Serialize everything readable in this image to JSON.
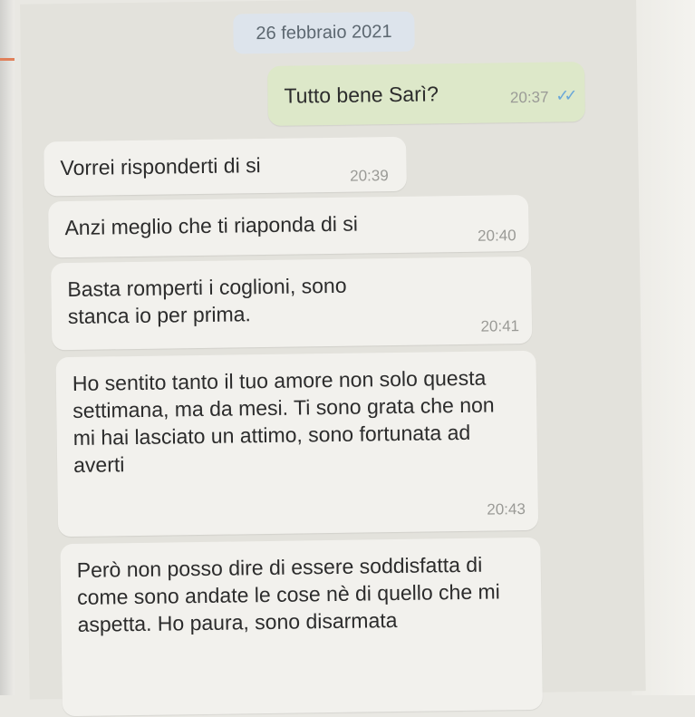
{
  "chat": {
    "date": "26 febbraio 2021",
    "messages": [
      {
        "direction": "outgoing",
        "text": "Tutto bene Sarì?",
        "time": "20:37",
        "status": "read-double-check"
      },
      {
        "direction": "incoming",
        "text": "Vorrei risponderti di si",
        "time": "20:39"
      },
      {
        "direction": "incoming",
        "text": "Anzi meglio che ti riaponda di si",
        "time": "20:40"
      },
      {
        "direction": "incoming",
        "text": "Basta romperti i coglioni, sono stanca io per prima.",
        "time": "20:41"
      },
      {
        "direction": "incoming",
        "text": "Ho sentito tanto il tuo amore non solo questa settimana, ma da mesi. Ti sono grata che non mi hai lasciato un attimo, sono fortunata ad averti",
        "time": "20:43"
      },
      {
        "direction": "incoming",
        "text": "Però non posso dire di essere soddisfatta di come sono andate le cose nè di quello che mi aspetta. Ho paura, sono disarmata",
        "time": ""
      }
    ]
  },
  "colors": {
    "incoming_bubble": "#f2f1ed",
    "outgoing_bubble": "#dde8c9",
    "read_ticks": "#6aa7d8",
    "date_chip": "#dde4ec"
  }
}
